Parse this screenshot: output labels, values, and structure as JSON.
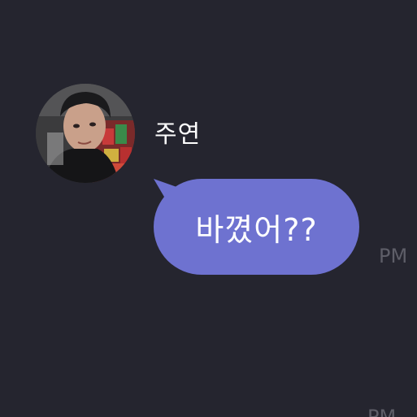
{
  "chat": {
    "message": {
      "sender_name": "주연",
      "avatar_icon": "profile-photo",
      "text": "바꼈어??",
      "time_partial": "PM"
    },
    "next_message": {
      "time_partial": "PM"
    }
  },
  "colors": {
    "background": "#25252f",
    "bubble": "#6e72d0",
    "text": "#ffffff",
    "timestamp": "#5e5e68"
  }
}
